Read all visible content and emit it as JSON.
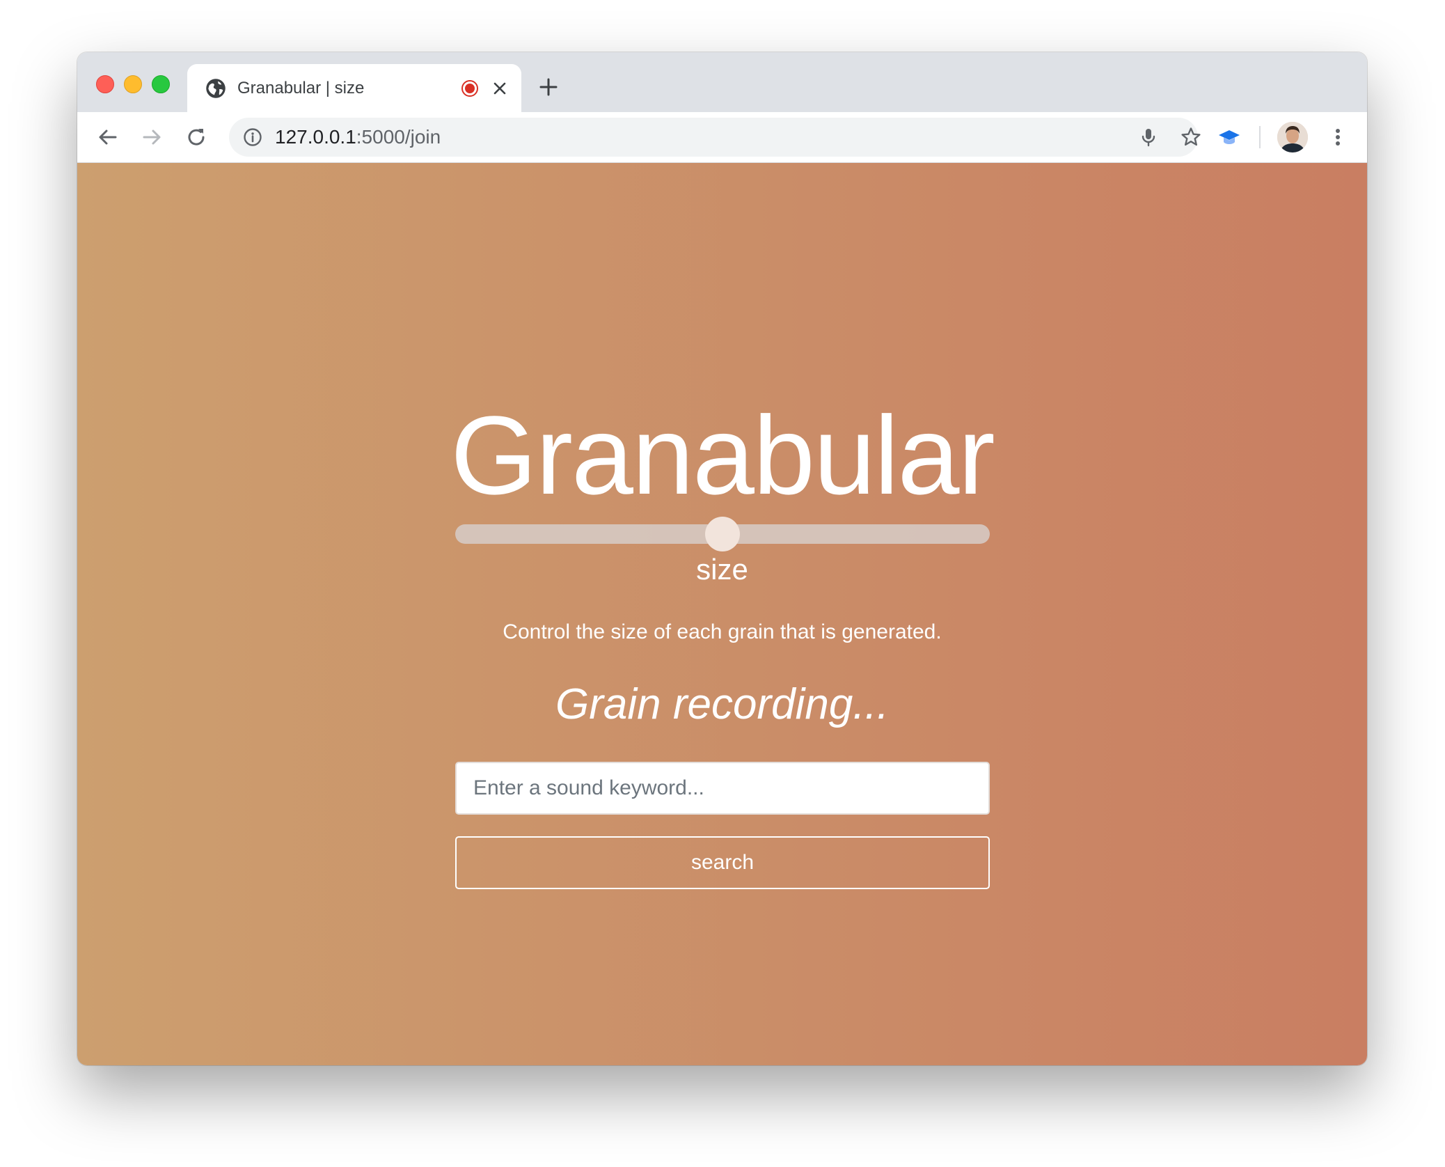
{
  "browser": {
    "tab": {
      "title": "Granabular | size",
      "favicon": "globe-icon",
      "recording_indicator": "record-icon",
      "close": "close-icon"
    },
    "new_tab": "plus-icon",
    "nav": {
      "back": "arrow-left-icon",
      "forward": "arrow-right-icon",
      "reload": "reload-icon"
    },
    "address_bar": {
      "host": "127.0.0.1",
      "path": ":5000/join",
      "info_icon": "info-icon",
      "mic_icon": "microphone-icon",
      "star_icon": "star-icon"
    },
    "extension_icon": "graduation-cap-icon",
    "profile_avatar": "avatar",
    "menu_icon": "kebab-menu-icon"
  },
  "page": {
    "background_gradient": [
      "#cc9f6f",
      "#c97e62"
    ],
    "title": "Granabular",
    "slider": {
      "label": "size",
      "value": 0.5
    },
    "description": "Control the size of each grain that is generated.",
    "status": "Grain recording...",
    "search": {
      "placeholder": "Enter a sound keyword...",
      "value": "",
      "button_label": "search"
    }
  }
}
